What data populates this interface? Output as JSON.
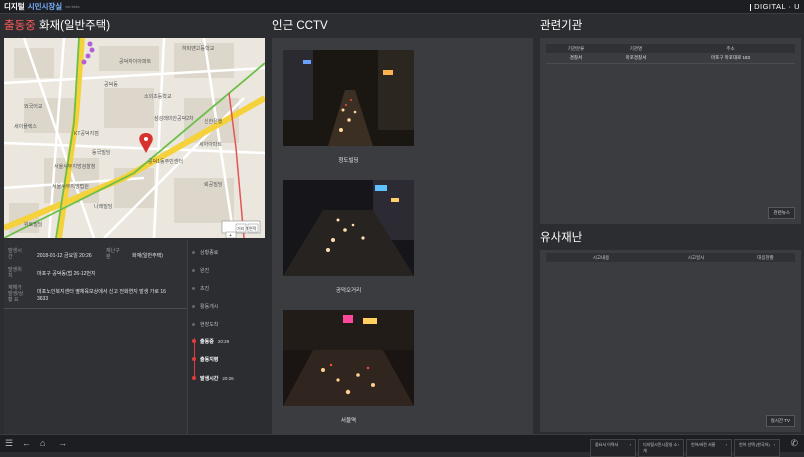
{
  "app": {
    "brand_primary": "디지털",
    "brand_secondary": "시민시장실",
    "beta": "ver.beta",
    "org_logo": "DIGITAL · U"
  },
  "incident": {
    "status": "출동중",
    "title": "화재(일반주택)",
    "fields": [
      {
        "label": "발생시간",
        "value": "2018-01-12 금요일 20:26",
        "label2": "재난구분",
        "value2": "화재(일반주택)"
      },
      {
        "label": "발생위치",
        "value": "마포구 공덕동(법 26-12번지"
      },
      {
        "label": "재해가 발생/상황 요",
        "value": "마포노인복지센터 옆체육보상에서 신고 전화연지 발생 가로 16 3633"
      }
    ]
  },
  "map": {
    "labels": [
      "공덕자이아파트",
      "하피맨고등학교",
      "외국어교",
      "회원교",
      "온솔아파트",
      "마포사랑아파트",
      "공덕동",
      "KT공덕지점",
      "LK공업빌딩",
      "동국빌딩",
      "삼성래미안공덕2차",
      "공덕1동주민센터",
      "삼성래미안공덕3차아파트",
      "서울서부지방검찰청",
      "서울서부지방법원",
      "마포한라",
      "나래빌딩",
      "세아아파트",
      "동부빌딩",
      "뢰공빌딩",
      "세이플렉스",
      "위토빌딩",
      "신한은행",
      "소의초등학교"
    ],
    "scale": "100m",
    "zoom_in": "+",
    "zoom_out": "−",
    "btn_distance": "거리",
    "btn_area": "면적"
  },
  "timeline": {
    "items": [
      {
        "label": "상황종료",
        "time": "",
        "active": false
      },
      {
        "label": "완진",
        "time": "",
        "active": false
      },
      {
        "label": "초진",
        "time": "",
        "active": false
      },
      {
        "label": "활동개시",
        "time": "",
        "active": false
      },
      {
        "label": "현장도착",
        "time": "",
        "active": false
      },
      {
        "label": "출동중",
        "time": "20:29",
        "active": true
      },
      {
        "label": "출동지령",
        "time": "",
        "active": true
      },
      {
        "label": "발생시간",
        "time": "20:26",
        "active": true
      }
    ]
  },
  "cctv": {
    "title": "인근 CCTV",
    "cams": [
      {
        "label": "청도빌딩"
      },
      {
        "label": "공덕오거리"
      },
      {
        "label": "서울역"
      }
    ]
  },
  "agencies": {
    "title": "관련기관",
    "columns": [
      "기관분류",
      "기관명",
      "주소"
    ],
    "rows": [
      [
        "경찰서",
        "마포경찰서",
        "마포구 마포대로 183"
      ]
    ],
    "button": "관련뉴스"
  },
  "similar": {
    "title": "유사재난",
    "columns": [
      "시고내용",
      "시고일시",
      "대응현황"
    ],
    "button": "실시간 TV"
  },
  "bottom": {
    "links": [
      "중요서 이력서",
      "디지털시민시장실 소개",
      "언어/버전 서울",
      "언어 선택 (한국어)"
    ]
  }
}
